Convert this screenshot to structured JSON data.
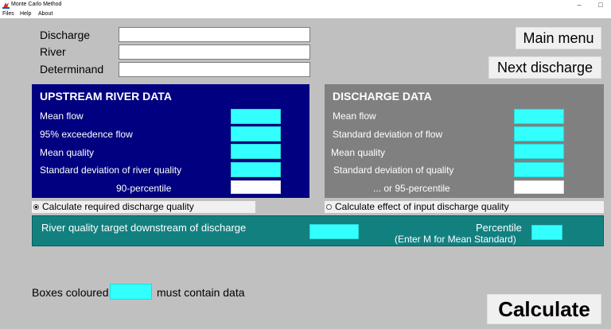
{
  "window": {
    "title": "Monte Carlo Method",
    "minimize_glyph": "–",
    "maximize_glyph": "□"
  },
  "menu": [
    "Files",
    "Help",
    "About"
  ],
  "form": {
    "discharge_label": "Discharge",
    "river_label": "River",
    "determinand_label": "Determinand",
    "discharge_value": "",
    "river_value": "",
    "determinand_value": ""
  },
  "buttons": {
    "main_menu": "Main menu",
    "next_discharge": "Next discharge",
    "calculate": "Calculate"
  },
  "upstream": {
    "title": "UPSTREAM RIVER DATA",
    "mean_flow": "Mean flow",
    "exceedence_flow": "95% exceedence flow",
    "mean_quality": "Mean quality",
    "sd_quality": "Standard deviation of river quality",
    "percentile_90": "90-percentile"
  },
  "discharge_data": {
    "title": "DISCHARGE DATA",
    "mean_flow": "Mean flow",
    "sd_flow": "Standard deviation of flow",
    "mean_quality": "Mean quality",
    "sd_quality": "Standard deviation of quality",
    "percentile_95": "... or 95-percentile"
  },
  "options": {
    "calc_required": "Calculate required discharge quality",
    "calc_effect": "Calculate effect of input discharge quality",
    "selected": "calc_required"
  },
  "target": {
    "label": "River quality target downstream of discharge",
    "percentile_label": "Percentile",
    "percentile_hint": "(Enter M for Mean Standard)"
  },
  "legend": {
    "prefix": "Boxes coloured",
    "suffix": "must contain data"
  },
  "colors": {
    "required_box": "#33ffff",
    "upstream_panel": "#000080",
    "discharge_panel": "#808080",
    "target_bar": "#138080",
    "background": "#c0c0c0"
  }
}
